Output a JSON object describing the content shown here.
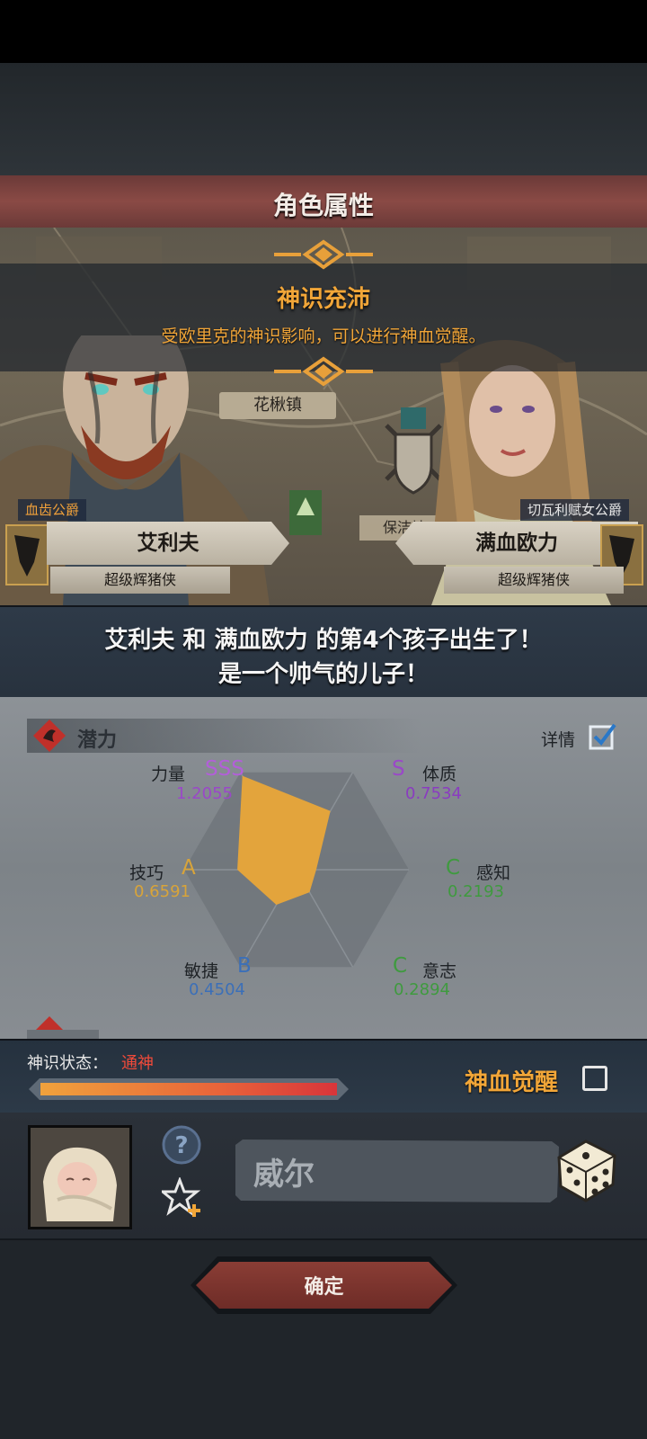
{
  "header": {
    "title": "角色属性"
  },
  "banner": {
    "title": "神识充沛",
    "description": "受欧里克的神识影响，可以进行神血觉醒。"
  },
  "scene": {
    "town_label": "花楸镇",
    "town_label_2": "保洁地"
  },
  "father": {
    "title": "血齿公爵",
    "name": "艾利夫",
    "subtitle": "超级辉猪侠",
    "crest_icon": "wolf-crest-icon"
  },
  "mother": {
    "title": "切瓦利赋女公爵",
    "name": "满血欧力",
    "subtitle": "超级辉猪侠",
    "crest_icon": "wolf-crest-icon"
  },
  "message": {
    "line1": "艾利夫 和 满血欧力 的第4个孩子出生了！",
    "line2": "是一个帅气的儿子！"
  },
  "potential": {
    "section_label": "潜力",
    "details_label": "详情",
    "details_checked": true,
    "stats": {
      "strength": {
        "name": "力量",
        "grade": "SSS",
        "value": "1.2055",
        "level": 1.2055,
        "color": "#b25fd8"
      },
      "constitution": {
        "name": "体质",
        "grade": "S",
        "value": "0.7534",
        "level": 0.7534,
        "color": "#9a48c8"
      },
      "perception": {
        "name": "感知",
        "grade": "C",
        "value": "0.2193",
        "level": 0.2193,
        "color": "#3f9a3f"
      },
      "willpower": {
        "name": "意志",
        "grade": "C",
        "value": "0.2894",
        "level": 0.2894,
        "color": "#3f9a3f"
      },
      "agility": {
        "name": "敏捷",
        "grade": "B",
        "value": "0.4504",
        "level": 0.4504,
        "color": "#3b6fb8"
      },
      "skill": {
        "name": "技巧",
        "grade": "A",
        "value": "0.6591",
        "level": 0.6591,
        "color": "#d8a43a"
      }
    },
    "radar_fill": "#e3a43c"
  },
  "divine": {
    "status_label": "神识状态：",
    "status_value": "通神",
    "progress": 1.0,
    "awaken_label": "神血觉醒",
    "awaken_checked": false
  },
  "naming": {
    "name_value": "威尔",
    "avatar_icon": "baby-avatar",
    "help_icon": "question-icon",
    "add_trait_icon": "star-plus-icon",
    "random_icon": "dice-icon"
  },
  "footer": {
    "confirm_label": "确定"
  }
}
